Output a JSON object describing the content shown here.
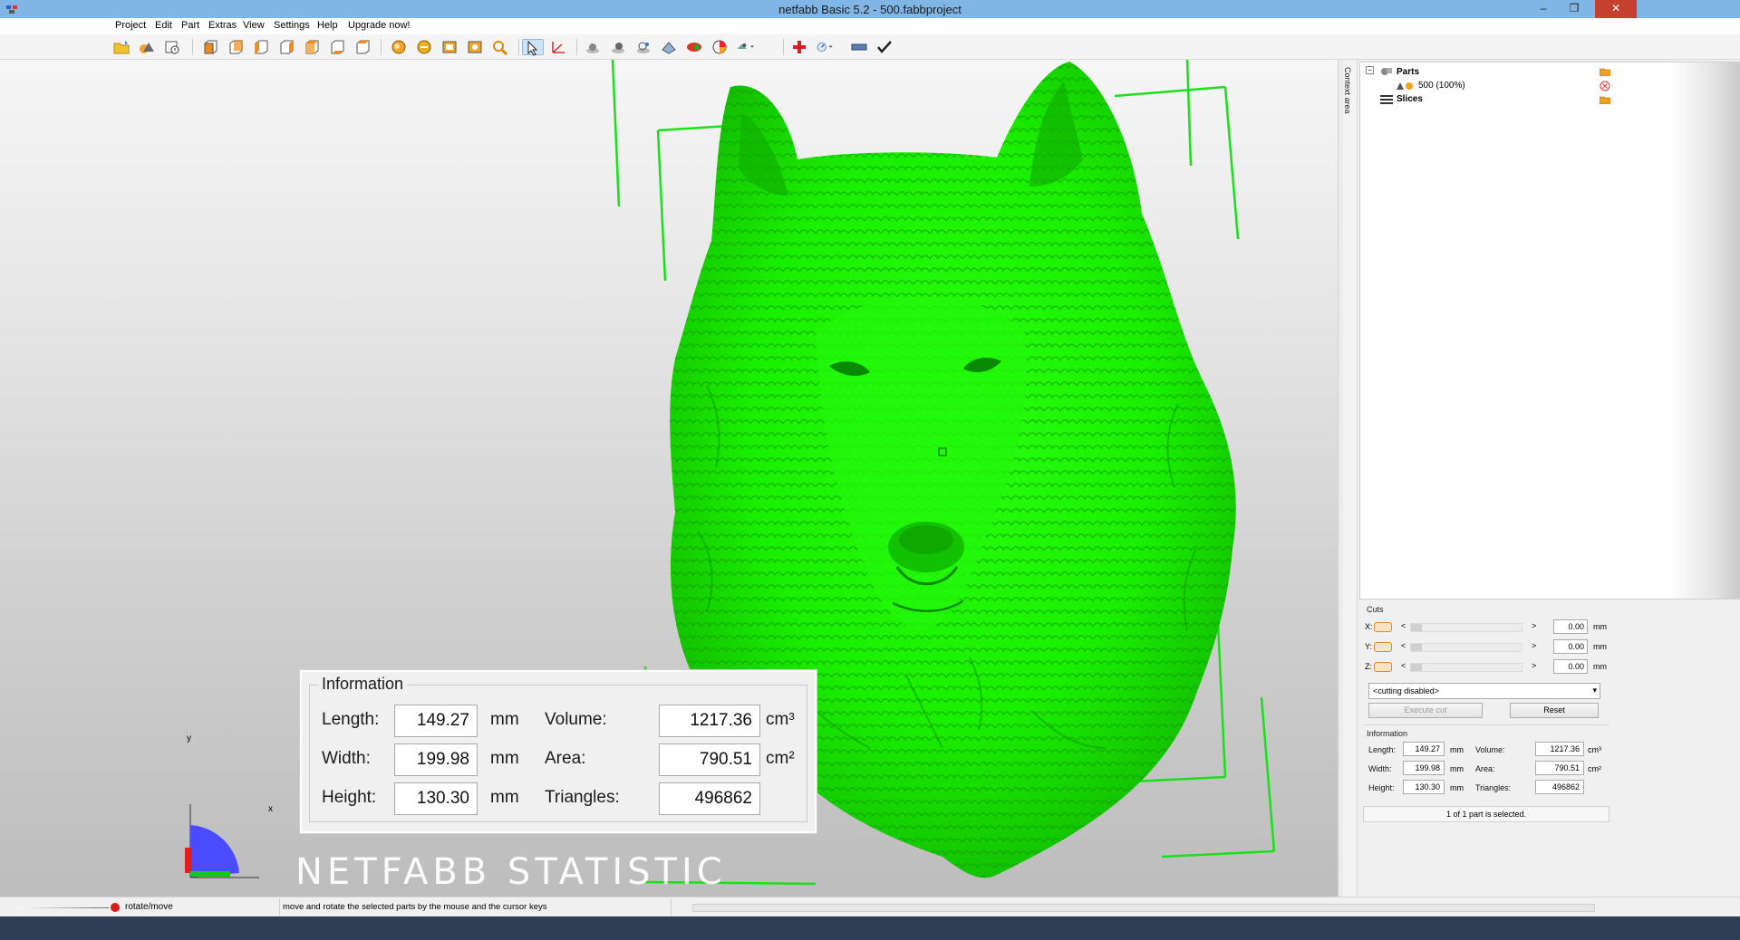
{
  "window": {
    "title": "netfabb Basic 5.2 - 500.fabbproject",
    "minimize": "–",
    "restore": "❐",
    "close": "✕"
  },
  "menu": [
    "Project",
    "Edit",
    "Part",
    "Extras",
    "View",
    "Settings",
    "Help",
    "Upgrade now!"
  ],
  "colors": {
    "model": "#1aef00",
    "bounding_box": "#19e019",
    "title_bar": "#7fb6e6",
    "close_button": "#c7402f"
  },
  "toolbar_icons": [
    "open-project-icon",
    "add-part-icon",
    "open-file-info-icon",
    "view-front-icon",
    "view-back-icon",
    "view-left-icon",
    "view-right-icon",
    "view-top-icon",
    "view-bottom-icon",
    "zoom-all-icon",
    "zoom-selection-icon",
    "zoom-fit-icon",
    "zoom-window-icon",
    "zoom-magnifier-icon",
    "select-cursor-icon",
    "measure-icon",
    "sphere-view-icon",
    "shaded-view-icon",
    "wireframe-view-icon",
    "cut-view-icon",
    "color-view-icon",
    "palette-icon",
    "lighting-icon",
    "repair-cross-icon",
    "analysis-gauge-icon",
    "slice-bar-icon",
    "checkmark-icon"
  ],
  "viewport": {
    "axis_y": "y",
    "axis_x": "x",
    "watermark": "NETFABB STATISTIC"
  },
  "info_overlay": {
    "title": "Information",
    "length_label": "Length:",
    "length_value": "149.27",
    "width_label": "Width:",
    "width_value": "199.98",
    "height_label": "Height:",
    "height_value": "130.30",
    "unit_mm": "mm",
    "volume_label": "Volume:",
    "volume_value": "1217.36",
    "volume_unit": "cm³",
    "area_label": "Area:",
    "area_value": "790.51",
    "area_unit": "cm²",
    "triangles_label": "Triangles:",
    "triangles_value": "496862"
  },
  "context_tab": "Context area",
  "tree": {
    "parts_label": "Parts",
    "part_name": "500 (100%)",
    "slices_label": "Slices",
    "expand_toggle": "−"
  },
  "cuts": {
    "title": "Cuts",
    "rows": [
      {
        "axis": "X:",
        "value": "0.00",
        "unit": "mm"
      },
      {
        "axis": "Y:",
        "value": "0.00",
        "unit": "mm"
      },
      {
        "axis": "Z:",
        "value": "0.00",
        "unit": "mm"
      }
    ],
    "less": "<",
    "greater": ">",
    "mode_selected": "<cutting disabled>",
    "execute_cut": "Execute cut",
    "reset": "Reset"
  },
  "info_panel": {
    "title": "Information",
    "length_label": "Length:",
    "length_value": "149.27",
    "width_label": "Width:",
    "width_value": "199.98",
    "height_label": "Height:",
    "height_value": "130.30",
    "unit_mm": "mm",
    "volume_label": "Volume:",
    "volume_value": "1217.36",
    "volume_unit": "cm³",
    "area_label": "Area:",
    "area_value": "790.51",
    "area_unit": "cm²",
    "triangles_label": "Triangles:",
    "triangles_value": "496862",
    "selection_status": "1 of 1 part is selected."
  },
  "statusbar": {
    "mode": "rotate/move",
    "hint": "move and rotate the selected parts by the mouse and the cursor keys"
  }
}
